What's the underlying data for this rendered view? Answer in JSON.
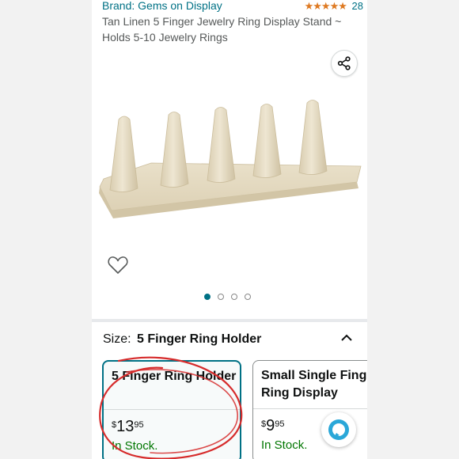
{
  "header": {
    "brand_link": "Brand: Gems on Display",
    "rating_stars": "★★★★★",
    "rating_count": "28",
    "product_title": "Tan Linen 5 Finger Jewelry Ring Display Stand ~ Holds 5-10 Jewelry Rings"
  },
  "icons": {
    "share": "share-icon",
    "wishlist": "heart-icon",
    "chevron": "chevron-up-icon",
    "alexa": "alexa-icon"
  },
  "gallery": {
    "image_count": 4,
    "active_index": 0
  },
  "size_selector": {
    "label": "Size:",
    "selected_value": "5 Finger Ring Holder"
  },
  "options": [
    {
      "name": "5 Finger Ring Holder",
      "price_symbol": "$",
      "price_whole": "13",
      "price_fraction": "95",
      "stock": "In Stock.",
      "selected": true
    },
    {
      "name": "Small Single Finger\nRing Display",
      "price_symbol": "$",
      "price_whole": "9",
      "price_fraction": "95",
      "stock": "In Stock.",
      "selected": false
    }
  ],
  "colors": {
    "link": "#007185",
    "stars": "#de7921",
    "in_stock": "#007600",
    "annotation_red": "#d62b2b",
    "linen": "#e6dcc3"
  }
}
